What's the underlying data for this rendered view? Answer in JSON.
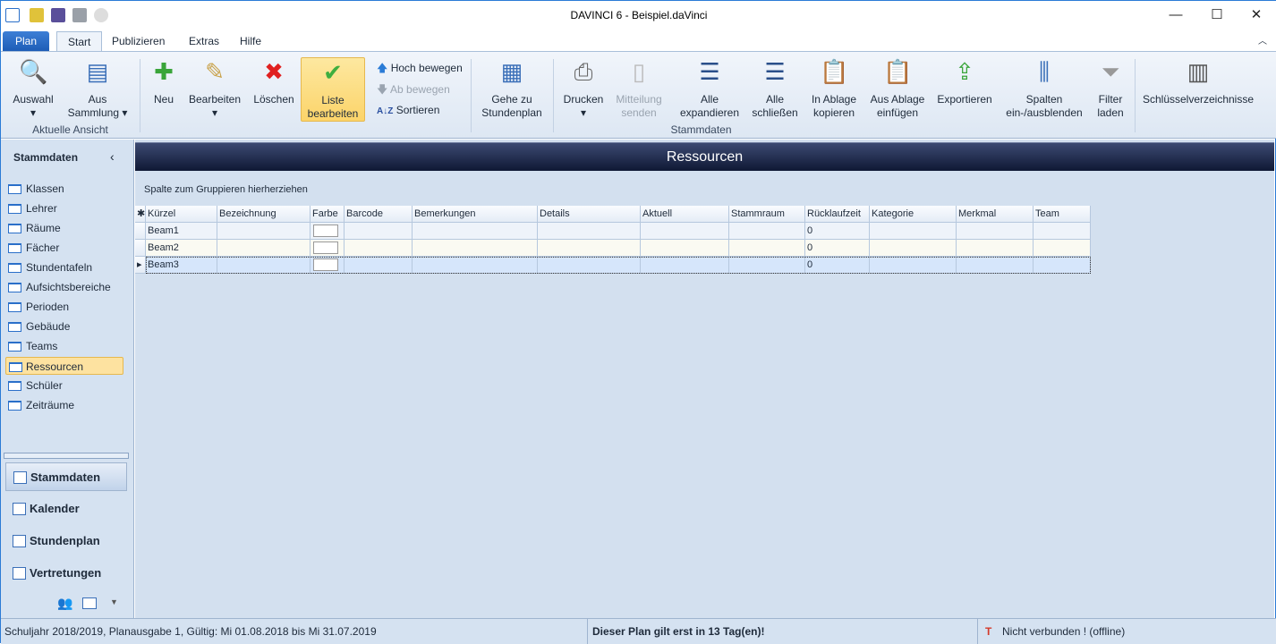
{
  "window": {
    "title": "DAVINCI 6 - Beispiel.daVinci",
    "controls": [
      "—",
      "☐",
      "✕"
    ]
  },
  "ribbon_tabs": [
    "Plan",
    "Start",
    "Publizieren",
    "Extras",
    "Hilfe"
  ],
  "ribbon": {
    "buttons": [
      {
        "l1": "Auswahl",
        "l2": "▾",
        "icon": "magnifier-window-icon"
      },
      {
        "l1": "Aus",
        "l2": "Sammlung ▾",
        "icon": "collection-icon"
      },
      {
        "l1": "Neu",
        "l2": "",
        "icon": "plus-icon"
      },
      {
        "l1": "Bearbeiten",
        "l2": "▾",
        "icon": "edit-document-icon"
      },
      {
        "l1": "Löschen",
        "l2": "",
        "icon": "delete-x-icon"
      },
      {
        "l1": "Liste",
        "l2": "bearbeiten",
        "icon": "checkmark-icon"
      },
      {
        "l1": "Gehe zu",
        "l2": "Stundenplan",
        "icon": "grid-table-icon"
      },
      {
        "l1": "Drucken",
        "l2": "▾",
        "icon": "printer-icon"
      },
      {
        "l1": "Mitteilung",
        "l2": "senden",
        "icon": "phone-message-icon"
      },
      {
        "l1": "Alle",
        "l2": "expandieren",
        "icon": "expand-all-icon"
      },
      {
        "l1": "Alle",
        "l2": "schließen",
        "icon": "collapse-all-icon"
      },
      {
        "l1": "In Ablage",
        "l2": "kopieren",
        "icon": "clipboard-copy-icon"
      },
      {
        "l1": "Aus Ablage",
        "l2": "einfügen",
        "icon": "clipboard-paste-icon"
      },
      {
        "l1": "Exportieren",
        "l2": "",
        "icon": "export-icon"
      },
      {
        "l1": "Spalten",
        "l2": "ein-/ausblenden",
        "icon": "columns-icon"
      },
      {
        "l1": "Filter",
        "l2": "laden",
        "icon": "funnel-icon"
      },
      {
        "l1": "Schlüsselverzeichnisse",
        "l2": "",
        "icon": "key-list-icon"
      }
    ],
    "small": [
      {
        "label": "Hoch bewegen",
        "icon": "arrow-up-icon"
      },
      {
        "label": "Ab bewegen",
        "icon": "arrow-down-icon"
      },
      {
        "label": "Sortieren",
        "icon": "sort-az-icon"
      }
    ],
    "groups": [
      "Aktuelle Ansicht",
      "Stammdaten"
    ]
  },
  "sidebar": {
    "title": "Stammdaten",
    "collapse": "‹",
    "items": [
      "Klassen",
      "Lehrer",
      "Räume",
      "Fächer",
      "Stundentafeln",
      "Aufsichtsbereiche",
      "Perioden",
      "Gebäude",
      "Teams",
      "Ressourcen",
      "Schüler",
      "Zeiträume"
    ],
    "selected": "Ressourcen",
    "sections": [
      "Stammdaten",
      "Kalender",
      "Stundenplan",
      "Vertretungen"
    ]
  },
  "main": {
    "header": "Ressourcen",
    "group_hint": "Spalte zum Gruppieren hierherziehen",
    "columns": [
      "Kürzel",
      "Bezeichnung",
      "Farbe",
      "Barcode",
      "Bemerkungen",
      "Details",
      "Aktuell",
      "Stammraum",
      "Rücklaufzeit",
      "Kategorie",
      "Merkmal",
      "Team"
    ],
    "rows": [
      [
        "Beam1",
        "",
        "",
        "",
        "",
        "",
        "",
        "",
        "0",
        "",
        "",
        ""
      ],
      [
        "Beam2",
        "",
        "",
        "",
        "",
        "",
        "",
        "",
        "0",
        "",
        "",
        ""
      ],
      [
        "Beam3",
        "",
        "",
        "",
        "",
        "",
        "",
        "",
        "0",
        "",
        "",
        ""
      ]
    ],
    "current_row": 2
  },
  "status": {
    "left": "Schuljahr 2018/2019, Planausgabe 1, Gültig: Mi 01.08.2018 bis Mi 31.07.2019",
    "center": "Dieser Plan gilt erst in 13 Tag(en)!",
    "right": "Nicht verbunden ! (offline)"
  }
}
